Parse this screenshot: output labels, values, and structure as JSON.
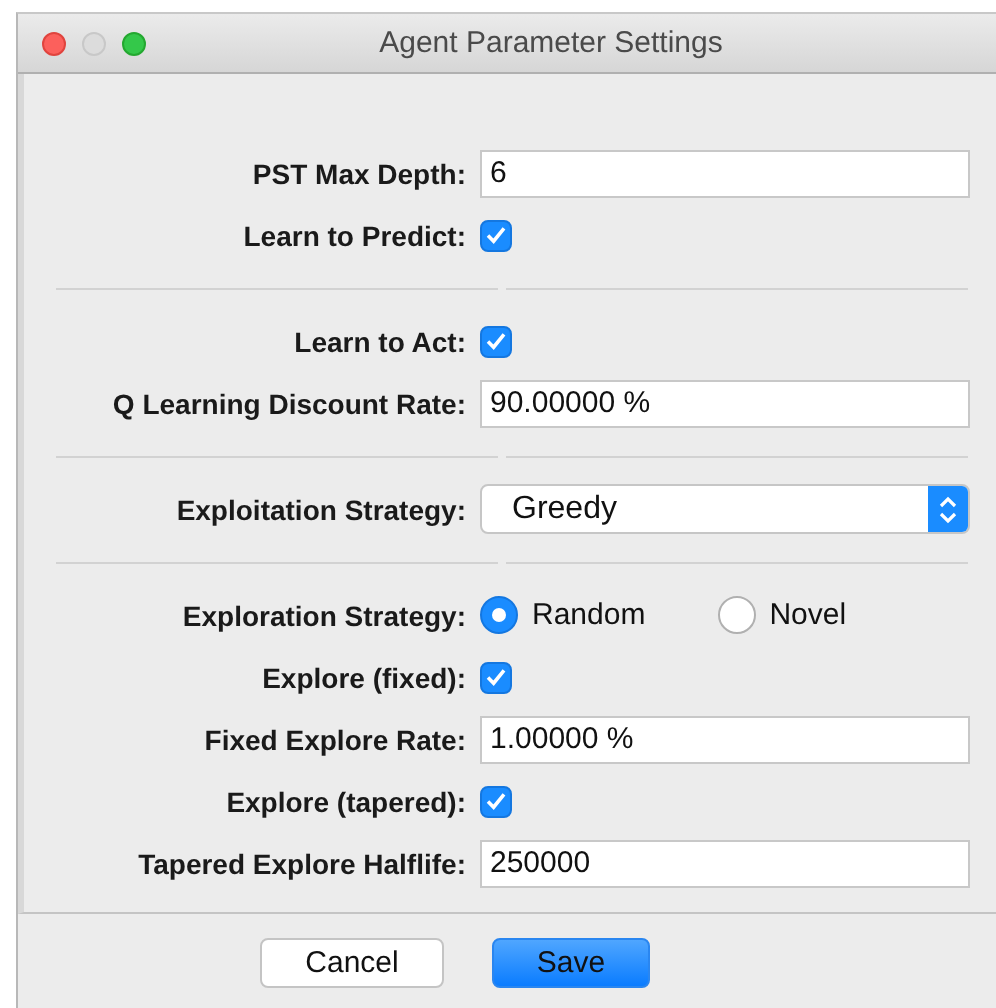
{
  "window": {
    "title": "Agent Parameter Settings"
  },
  "rows": [
    {
      "kind": "text",
      "label": "PST Max Depth:",
      "value": "6"
    },
    {
      "kind": "checkbox",
      "label": "Learn to Predict:",
      "checked": true
    },
    {
      "kind": "separator"
    },
    {
      "kind": "checkbox",
      "label": "Learn to Act:",
      "checked": true
    },
    {
      "kind": "text",
      "label": "Q Learning Discount Rate:",
      "value": "90.00000 %"
    },
    {
      "kind": "separator"
    },
    {
      "kind": "select",
      "label": "Exploitation Strategy:",
      "value": "Greedy"
    },
    {
      "kind": "separator"
    },
    {
      "kind": "radio",
      "label": "Exploration Strategy:",
      "options": [
        {
          "label": "Random",
          "selected": true
        },
        {
          "label": "Novel",
          "selected": false
        }
      ]
    },
    {
      "kind": "checkbox",
      "label": "Explore (fixed):",
      "checked": true
    },
    {
      "kind": "text",
      "label": "Fixed Explore Rate:",
      "value": "1.00000 %"
    },
    {
      "kind": "checkbox",
      "label": "Explore (tapered):",
      "checked": true
    },
    {
      "kind": "text",
      "label": "Tapered Explore Halflife:",
      "value": "250000"
    }
  ],
  "buttons": [
    {
      "label": "Cancel",
      "default": false
    },
    {
      "label": "Save",
      "default": true
    }
  ]
}
